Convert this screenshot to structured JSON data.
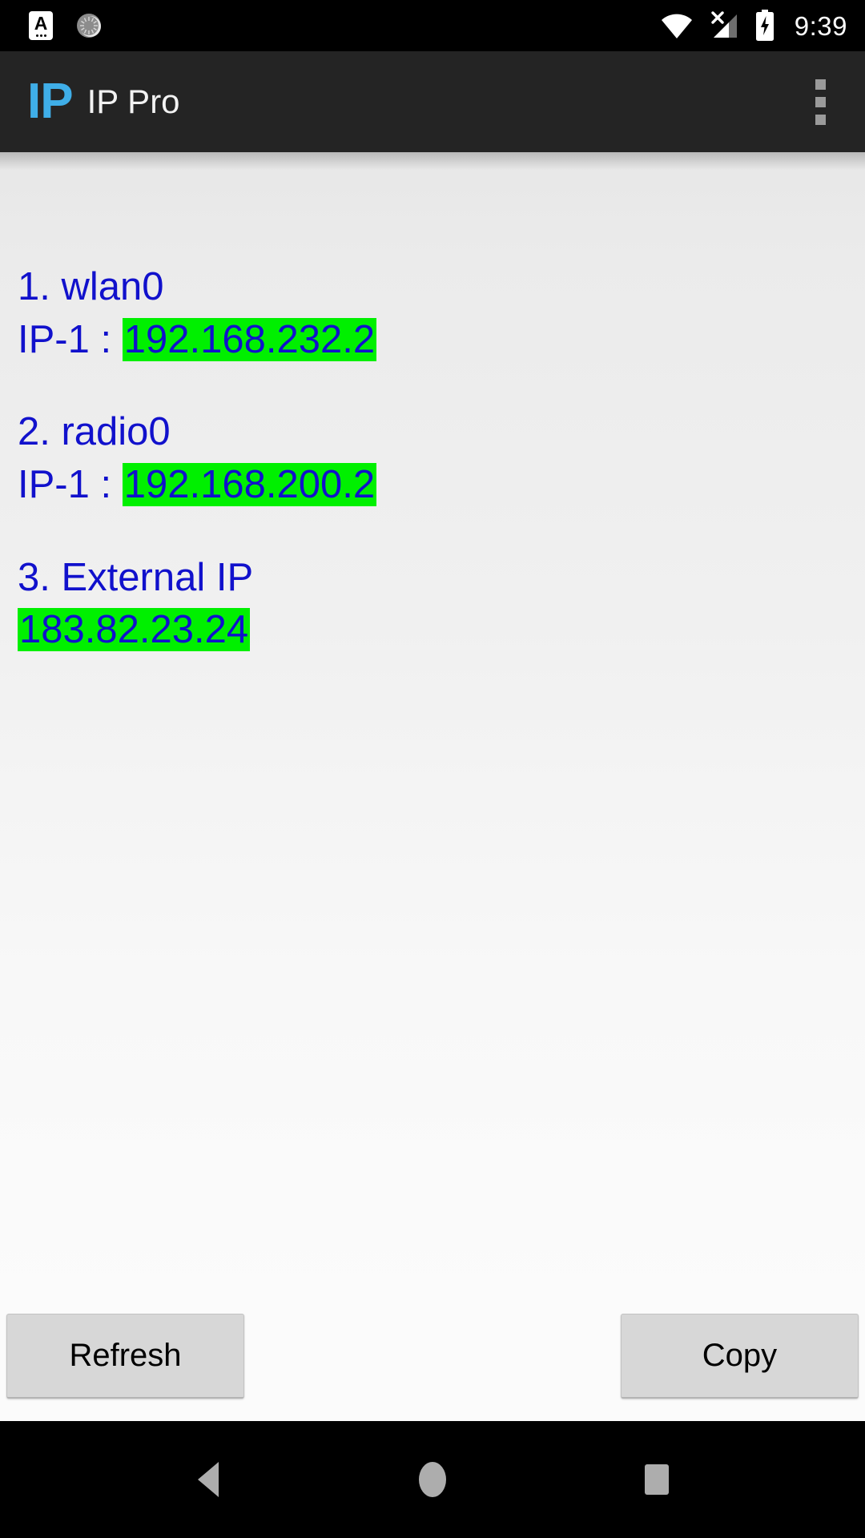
{
  "status_bar": {
    "left_icons": [
      {
        "name": "input-method-icon",
        "glyph": "A"
      },
      {
        "name": "sync-sunburst-icon",
        "glyph": "☀"
      }
    ],
    "right_icons": [
      {
        "name": "wifi-icon",
        "label": "wifi-full"
      },
      {
        "name": "cellular-no-service-icon",
        "label": "no-sim"
      },
      {
        "name": "battery-charging-icon",
        "label": "charging"
      }
    ],
    "time": "9:39"
  },
  "app_bar": {
    "logo_text": "IP",
    "title": "IP Pro",
    "logo_color": "#3FAEE8",
    "background": "#242424",
    "overflow_menu_label": "More options"
  },
  "content": {
    "highlight_color": "#00F000",
    "text_color": "#1111CC",
    "entries": [
      {
        "index": "1.",
        "name": "wlan0",
        "title": "1. wlan0",
        "ip_label": "IP-1 : ",
        "ip_value": "192.168.232.2",
        "has_label": true
      },
      {
        "index": "2.",
        "name": "radio0",
        "title": "2. radio0",
        "ip_label": "IP-1 : ",
        "ip_value": "192.168.200.2",
        "has_label": true
      },
      {
        "index": "3.",
        "name": "External IP",
        "title": "3. External IP",
        "ip_label": "",
        "ip_value": "183.82.23.24",
        "has_label": false
      }
    ]
  },
  "buttons": {
    "refresh_label": "Refresh",
    "copy_label": "Copy"
  },
  "nav_bar": {
    "back_label": "Back",
    "home_label": "Home",
    "recents_label": "Recent apps"
  }
}
